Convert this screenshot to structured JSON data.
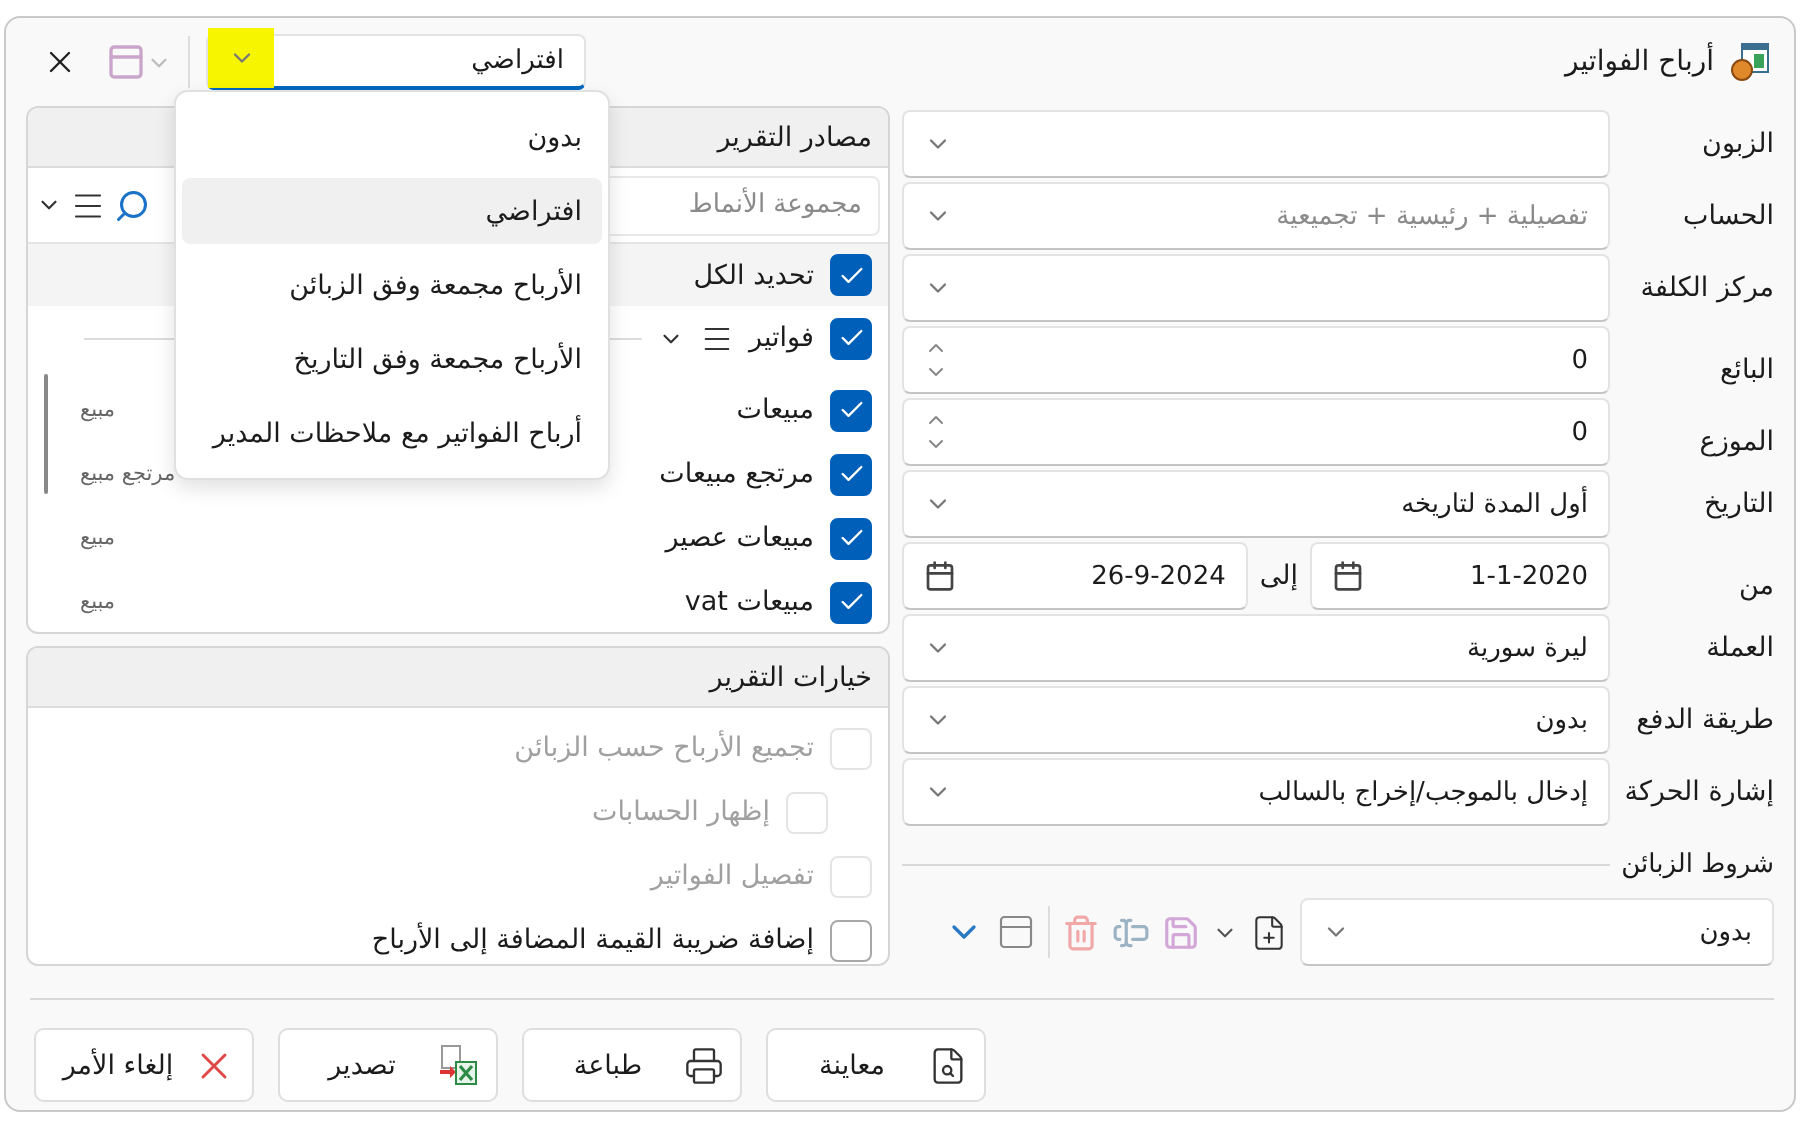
{
  "window": {
    "title": "أرباح الفواتير"
  },
  "layout_picker": {
    "value": "افتراضي",
    "open": true,
    "options": [
      {
        "label": "بدون",
        "selected": false
      },
      {
        "label": "افتراضي",
        "selected": true
      },
      {
        "label": "الأرباح مجمعة وفق الزبائن",
        "selected": false
      },
      {
        "label": "الأرباح مجمعة وفق التاريخ",
        "selected": false
      },
      {
        "label": "أرباح الفواتير مع ملاحظات المدير",
        "selected": false
      }
    ]
  },
  "fields": [
    {
      "kind": "combo",
      "label": "الزبون"
    },
    {
      "kind": "combo",
      "label": "الحساب",
      "placeholder": "تفصيلية + رئيسية + تجميعية"
    },
    {
      "kind": "combo",
      "label": "مركز الكلفة"
    },
    {
      "kind": "spin",
      "label": "البائع",
      "value": "0"
    },
    {
      "kind": "spin",
      "label": "الموزع",
      "value": "0"
    },
    {
      "kind": "combo",
      "label": "التاريخ",
      "value": "أول المدة لتاريخه"
    },
    {
      "kind": "range",
      "label": "من",
      "value": "1-1-2020",
      "to_label": "إلى",
      "to_value": "26-9-2024"
    },
    {
      "kind": "combo",
      "label": "العملة",
      "value": "ليرة سورية"
    },
    {
      "kind": "combo",
      "label": "طريقة الدفع",
      "value": "بدون"
    },
    {
      "kind": "combo",
      "label": "إشارة الحركة",
      "value": "إدخال بالموجب/إخراج بالسالب"
    }
  ],
  "customer_conditions": {
    "title": "شروط الزبائن",
    "value": "بدون"
  },
  "sources": {
    "title": "مصادر التقرير",
    "search_placeholder": "مجموعة الأنماط",
    "select_all": {
      "label": "تحديد الكل",
      "checked": true
    },
    "groups": [
      {
        "label": "فواتير",
        "checked": true,
        "expanded": true,
        "children": [
          {
            "label": "مبيعات",
            "type": "مبيع",
            "checked": true
          },
          {
            "label": "مرتجع مبيعات",
            "type": "مرتجع مبيع",
            "checked": true
          },
          {
            "label": "مبيعات عصير",
            "type": "مبيع",
            "checked": true
          },
          {
            "label": "مبيعات vat",
            "type": "مبيع",
            "checked": true
          }
        ]
      }
    ]
  },
  "options": {
    "title": "خيارات التقرير",
    "items": [
      {
        "label": "تجميع الأرباح حسب الزبائن",
        "checked": false,
        "disabled": true,
        "children": [
          {
            "label": "إظهار الحسابات",
            "checked": false,
            "disabled": true
          }
        ]
      },
      {
        "label": "تفصيل الفواتير",
        "checked": false,
        "disabled": true
      },
      {
        "label": "إضافة ضريبة القيمة المضافة إلى الأرباح",
        "checked": false,
        "disabled": false
      }
    ]
  },
  "buttons": [
    {
      "kind": "preview",
      "label": "معاينة"
    },
    {
      "kind": "print",
      "label": "طباعة"
    },
    {
      "kind": "export",
      "label": "تصدير"
    },
    {
      "kind": "cancel",
      "label": "إلغاء الأمر"
    }
  ]
}
